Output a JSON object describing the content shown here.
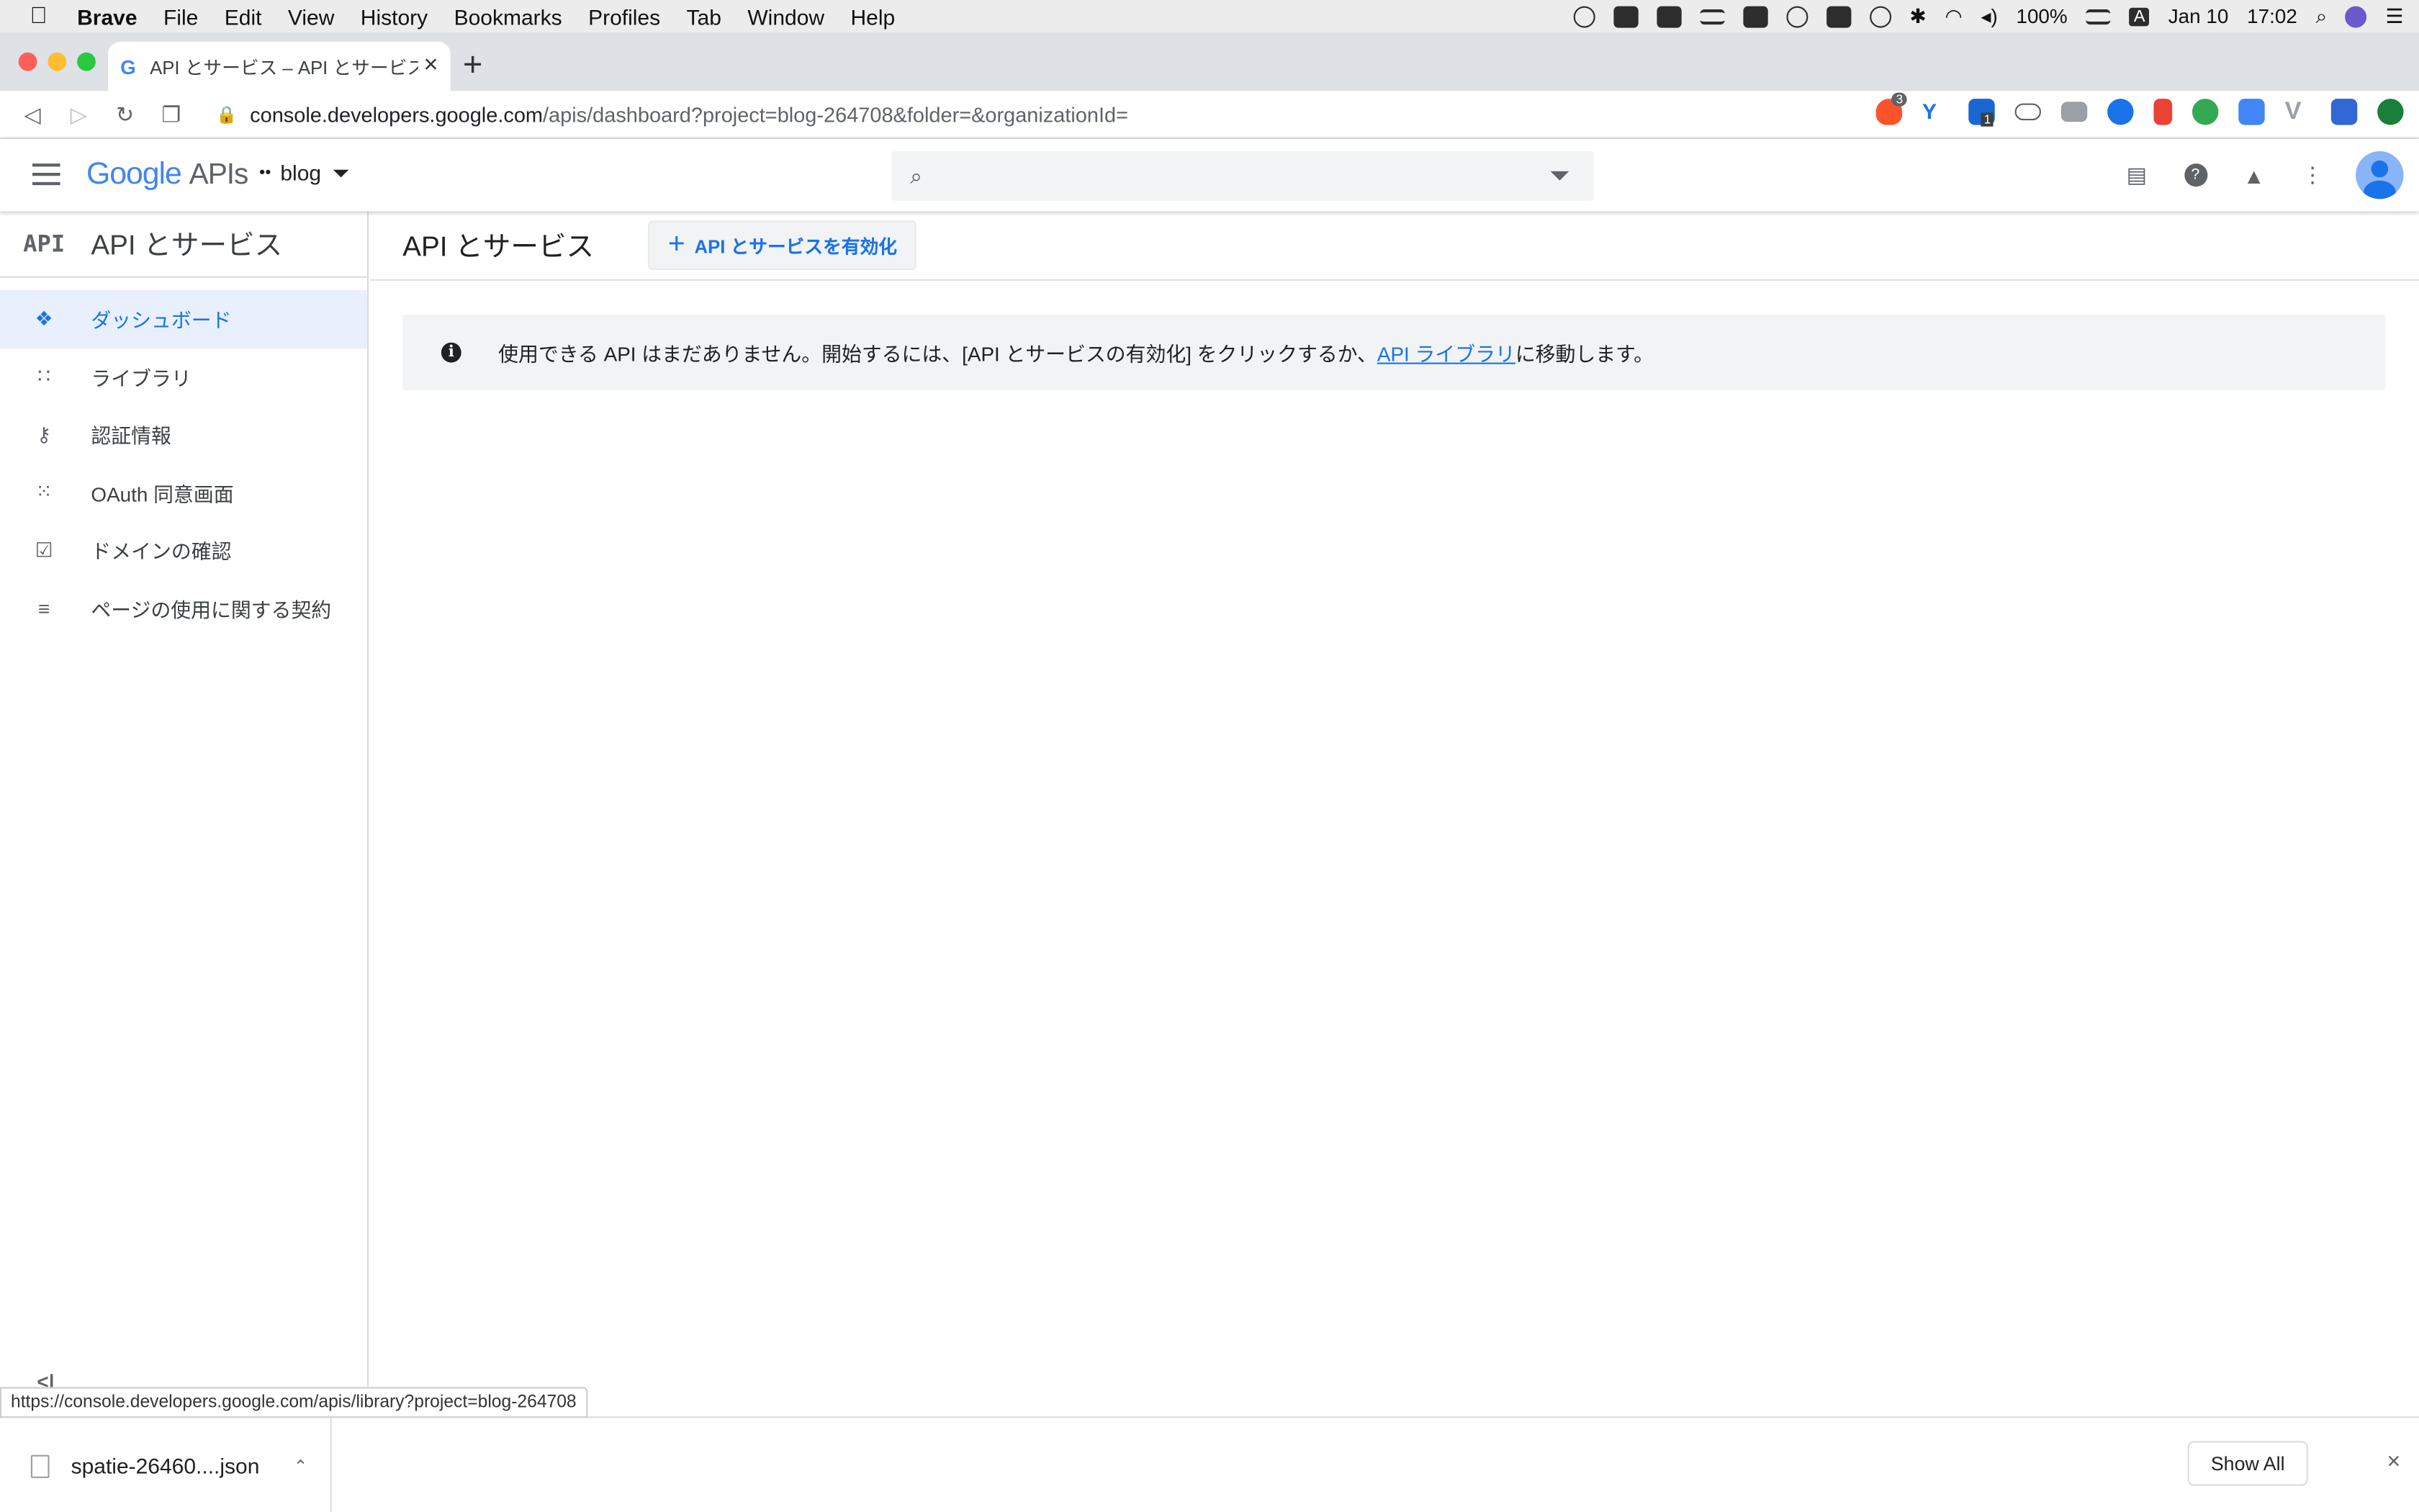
{
  "menubar": {
    "items": [
      "Brave",
      "File",
      "Edit",
      "View",
      "History",
      "Bookmarks",
      "Profiles",
      "Tab",
      "Window",
      "Help"
    ],
    "battery": "100%",
    "date": "Jan 10",
    "time": "17:02",
    "input_source": "A"
  },
  "tab": {
    "title": "API とサービス – API とサービス – blog",
    "favicon": "G"
  },
  "address": {
    "host": "console.developers.google.com",
    "path": "/apis/dashboard?project=blog-264708&folder=&organizationId=",
    "brave_badge": "3",
    "ext_badge": "1"
  },
  "header": {
    "logo_google": "Google",
    "logo_apis": "APIs",
    "project": "blog",
    "search_placeholder": ""
  },
  "sidebar": {
    "icon_text": "API",
    "title": "API とサービス",
    "items": [
      {
        "label": "ダッシュボード",
        "icon": "dashboard-icon",
        "active": true
      },
      {
        "label": "ライブラリ",
        "icon": "library-icon"
      },
      {
        "label": "認証情報",
        "icon": "key-icon"
      },
      {
        "label": "OAuth 同意画面",
        "icon": "oauth-icon"
      },
      {
        "label": "ドメインの確認",
        "icon": "checkbox-icon"
      },
      {
        "label": "ページの使用に関する契約",
        "icon": "settings-list-icon"
      }
    ],
    "collapse_glyph": "<|"
  },
  "main": {
    "title": "API とサービス",
    "enable_button": "API とサービスを有効化",
    "info_prefix": "使用できる API はまだありません。開始するには、[API とサービスの有効化] をクリックするか、",
    "info_link": "API ライブラリ",
    "info_suffix": "に移動します。"
  },
  "status_url": "https://console.developers.google.com/apis/library?project=blog-264708",
  "downloads": {
    "file": "spatie-26460....json",
    "show_all": "Show All"
  },
  "colors": {
    "accent": "#1a73e8",
    "sidebar_active_bg": "#e8f0fe",
    "info_bg": "#f1f3f4"
  }
}
